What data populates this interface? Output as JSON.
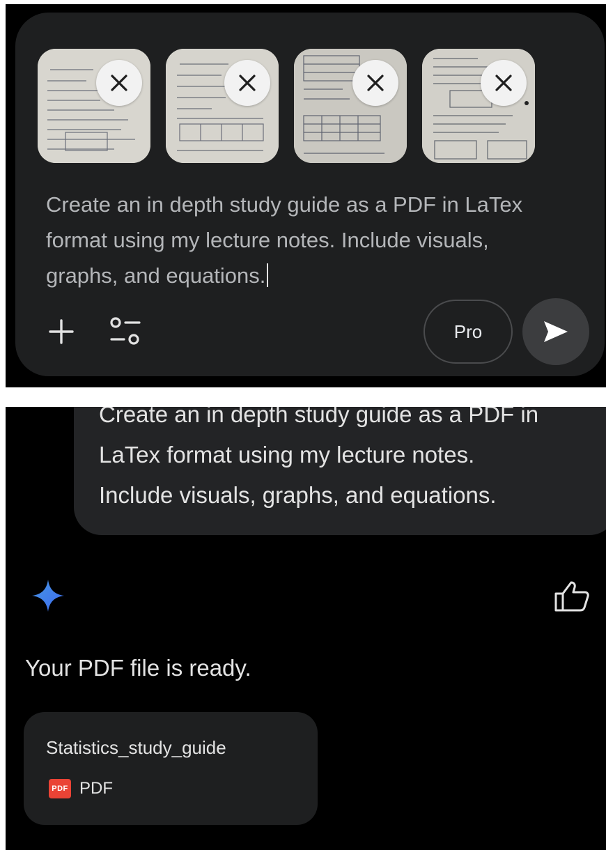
{
  "composer": {
    "attachments": [
      {
        "label": "lecture-notes-1"
      },
      {
        "label": "lecture-notes-2"
      },
      {
        "label": "lecture-notes-3"
      },
      {
        "label": "lecture-notes-4"
      }
    ],
    "prompt_lines": [
      "Create an in depth study guide as a PDF in LaTex",
      "format using my lecture notes. Include visuals,",
      "graphs, and equations."
    ],
    "model_button_label": "Pro",
    "icons": {
      "add": "plus-icon",
      "tools": "tune-icon",
      "send": "send-icon",
      "remove": "close-icon"
    }
  },
  "conversation": {
    "user_message_lines": [
      "Create an in depth study guide as a PDF in",
      "LaTex format using my lecture notes.",
      "Include visuals, graphs, and equations."
    ],
    "assistant_text": "Your PDF file is ready.",
    "file": {
      "name": "Statistics_study_guide",
      "badge": "PDF",
      "type": "PDF"
    }
  },
  "colors": {
    "background": "#000000",
    "surface": "#1e1f20",
    "user_bubble": "#232426",
    "accent_blue": "#4285f4",
    "pdf_red": "#ea4335"
  }
}
